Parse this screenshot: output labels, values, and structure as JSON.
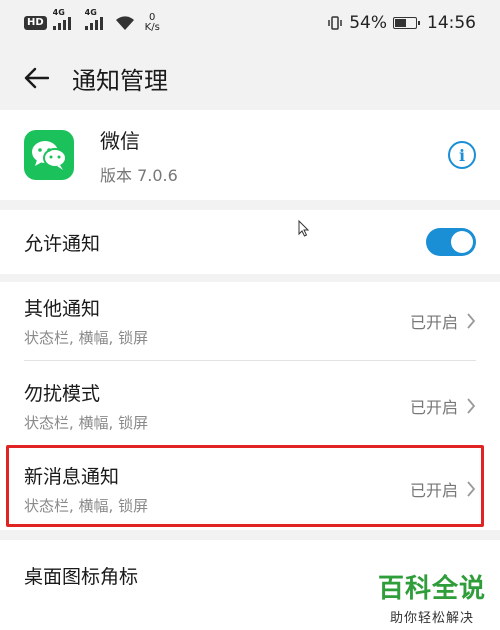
{
  "status_bar": {
    "hd": "HD",
    "sig1": "4G",
    "sig2": "4G",
    "net_speed": "0",
    "net_unit": "K/s",
    "battery": "54%",
    "battery_level": 0.54,
    "time": "14:56"
  },
  "header": {
    "title": "通知管理"
  },
  "app": {
    "name": "微信",
    "version": "版本 7.0.6",
    "icon_color": "#1bc15b"
  },
  "allow_notifications": {
    "label": "允许通知",
    "enabled": true
  },
  "items": [
    {
      "title": "其他通知",
      "subtitle": "状态栏, 横幅, 锁屏",
      "status": "已开启"
    },
    {
      "title": "勿扰模式",
      "subtitle": "状态栏, 横幅, 锁屏",
      "status": "已开启"
    },
    {
      "title": "新消息通知",
      "subtitle": "状态栏, 横幅, 锁屏",
      "status": "已开启"
    }
  ],
  "badge": {
    "label": "桌面图标角标"
  },
  "watermark": {
    "main": "百科全说",
    "sub": "助你轻松解决"
  },
  "colors": {
    "accent": "#1a8fd6",
    "highlight": "#e02424",
    "watermark": "#2e9d3a"
  }
}
